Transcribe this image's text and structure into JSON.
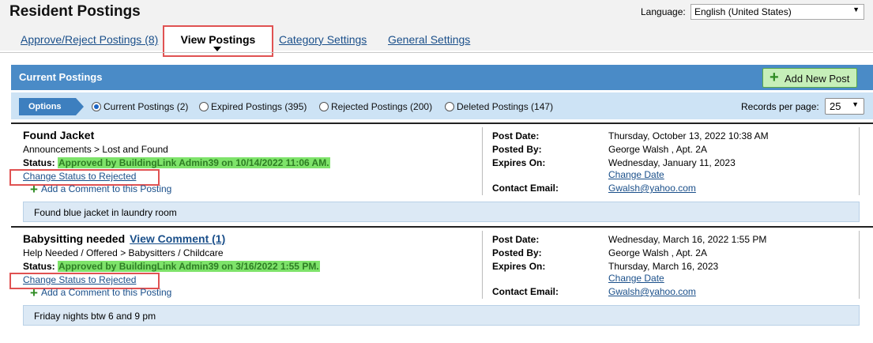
{
  "page": {
    "title": "Resident Postings",
    "language_label": "Language:",
    "language_value": "English (United States)"
  },
  "tabs": [
    {
      "label": "Approve/Reject Postings (8)",
      "active": false
    },
    {
      "label": "View Postings",
      "active": true
    },
    {
      "label": "Category Settings",
      "active": false
    },
    {
      "label": "General Settings",
      "active": false
    }
  ],
  "panel": {
    "title": "Current Postings",
    "add_button": "Add New Post"
  },
  "options": {
    "label": "Options",
    "filters": [
      {
        "label": "Current Postings (2)",
        "selected": true
      },
      {
        "label": "Expired Postings (395)",
        "selected": false
      },
      {
        "label": "Rejected Postings (200)",
        "selected": false
      },
      {
        "label": "Deleted Postings (147)",
        "selected": false
      }
    ],
    "records_label": "Records per page:",
    "records_value": "25"
  },
  "labels": {
    "status": "Status:",
    "change_status": "Change Status to Rejected",
    "add_comment": "Add a Comment to this Posting",
    "post_date": "Post Date:",
    "posted_by": "Posted By:",
    "expires_on": "Expires On:",
    "contact_email": "Contact Email:",
    "change_date": "Change Date"
  },
  "posts": [
    {
      "title": "Found Jacket",
      "view_comment": "",
      "category": "Announcements > Lost and Found",
      "status": "Approved by BuildingLink Admin39 on 10/14/2022 11:06 AM.",
      "post_date": "Thursday, October 13, 2022 10:38 AM",
      "posted_by": "George Walsh , Apt. 2A",
      "expires_on": "Wednesday, January 11, 2023",
      "contact_email": "Gwalsh@yahoo.com",
      "body": "Found blue jacket in laundry room"
    },
    {
      "title": "Babysitting needed",
      "view_comment": "View  Comment (1) ",
      "category": "Help Needed / Offered > Babysitters / Childcare",
      "status": "Approved by BuildingLink Admin39 on 3/16/2022 1:55 PM.",
      "post_date": "Wednesday, March 16, 2022 1:55 PM",
      "posted_by": "George Walsh , Apt. 2A",
      "expires_on": "Thursday, March 16, 2023",
      "contact_email": "Gwalsh@yahoo.com",
      "body": "Friday nights btw 6 and 9 pm"
    }
  ],
  "icons": {
    "add_button": "plus-icon",
    "add_comment": "plus-icon",
    "dropdown": "chevron-down-icon"
  },
  "colors": {
    "header_blue": "#4a8bc7",
    "options_bg": "#cde3f5",
    "approved_highlight": "#7ee36a",
    "link": "#1a4f8a",
    "annotation_red": "#e05252"
  }
}
